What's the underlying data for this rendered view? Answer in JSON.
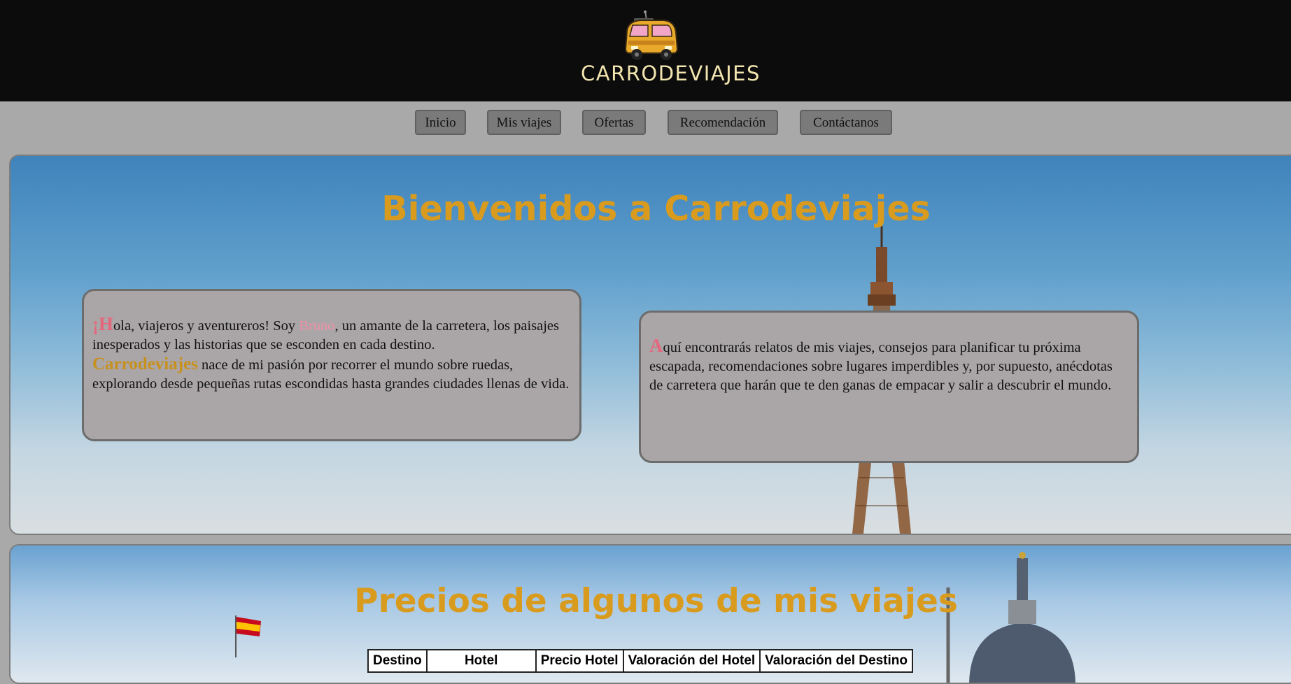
{
  "header": {
    "logo_icon": "van-icon",
    "brand": "CARRODEVIAJES"
  },
  "nav": {
    "items": [
      {
        "label": "Inicio"
      },
      {
        "label": "Mis viajes"
      },
      {
        "label": "Ofertas"
      },
      {
        "label": "Recomendación"
      },
      {
        "label": "Contáctanos"
      }
    ]
  },
  "hero": {
    "title": "Bienvenidos a Carrodeviajes",
    "background_icon": "eiffel-tower-icon",
    "card_left": {
      "drop": "¡H",
      "text_1": "ola, viajeros y aventureros! Soy ",
      "name": "Bruno",
      "text_2": ", un amante de la carretera, los paisajes inesperados y las historias que se esconden en cada destino.",
      "brand": "Carrodeviajes",
      "text_3": " nace de mi pasión por recorrer el mundo sobre ruedas, explorando desde pequeñas rutas escondidas hasta grandes ciudades llenas de vida."
    },
    "card_right": {
      "drop": "A",
      "text": "quí encontrarás relatos de mis viajes, consejos para planificar tu próxima escapada, recomendaciones sobre lugares imperdibles y, por supuesto, anécdotas de carretera que harán que te den ganas de empacar y salir a descubrir el mundo."
    }
  },
  "prices": {
    "title": "Precios de algunos de mis viajes",
    "columns": [
      "Destino",
      "Hotel",
      "Precio Hotel",
      "Valoración del Hotel",
      "Valoración del Destino"
    ]
  },
  "colors": {
    "accent": "#d99b1e",
    "header_bg": "#0c0c0c",
    "page_bg": "#a9a9a9",
    "highlight": "#e5677e"
  }
}
